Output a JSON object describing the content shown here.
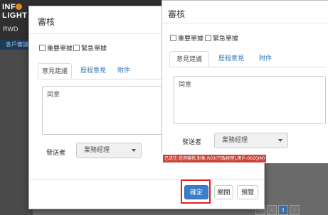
{
  "background": {
    "logo_text_1": "INF",
    "logo_text_2": "LIGHT",
    "app_label": "RWD",
    "menu_item": "客戶審議",
    "pager": [
      "‹",
      "‹",
      "1",
      "›"
    ]
  },
  "dialog_left": {
    "title": "審核",
    "checkbox_important": "重要單據",
    "checkbox_urgent": "緊急單據",
    "tabs": [
      "意見建議",
      "歷程意見",
      "附件"
    ],
    "comment_value": "同意",
    "sender_label": "發送者",
    "sender_value": "業務經理",
    "buttons": {
      "confirm": "確定",
      "close": "關閉",
      "preview": "預覽"
    }
  },
  "dialog_right": {
    "title": "審核",
    "checkbox_important": "重要單據",
    "checkbox_urgent": "緊急單據",
    "tabs": [
      "意見建議",
      "歷程意見",
      "附件"
    ],
    "comment_value": "同意",
    "sender_label": "發送者",
    "sender_value": "業務經理",
    "error_message": "已送往:信用審核,對象:R03(行政經理),用戶:002(JIM)"
  },
  "colors": {
    "primary": "#3a7dc8",
    "error": "#c9433a",
    "highlight": "#e02020",
    "link": "#337ab7"
  }
}
